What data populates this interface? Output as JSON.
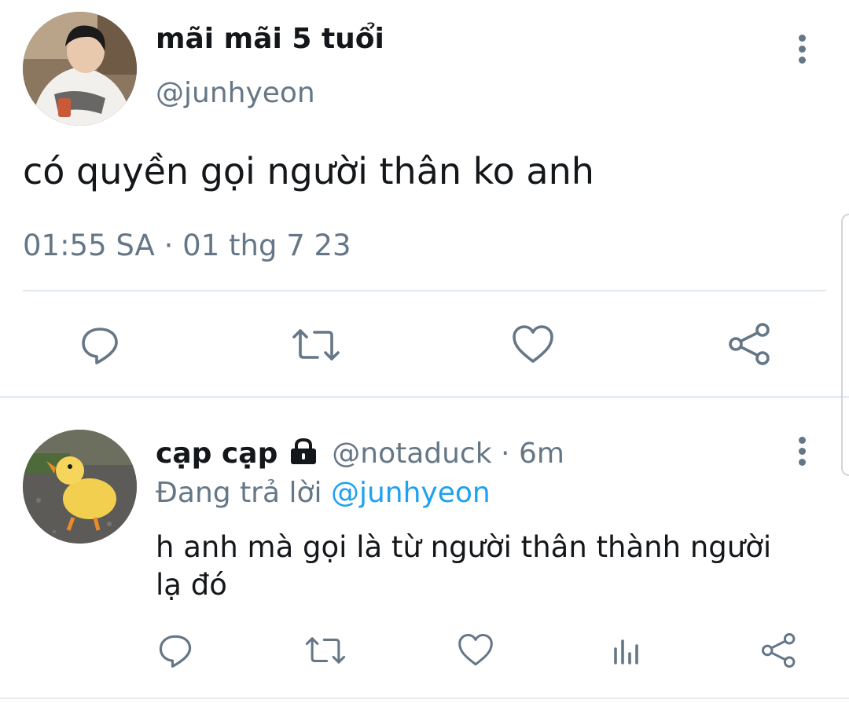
{
  "main_tweet": {
    "display_name": "mãi mãi 5 tuổi",
    "handle": "@junhyeon",
    "text": "có quyền gọi người thân ko anh",
    "timestamp": "01:55 SA · 01 thg 7 23",
    "avatar_icon": "person-in-white-hoodie-photo",
    "actions": [
      "reply-icon",
      "retweet-icon",
      "like-icon",
      "share-icon"
    ]
  },
  "reply": {
    "display_name": "cạp cạp",
    "lock_icon": "lock-icon",
    "handle": "@notaduck",
    "separator": "·",
    "time": "6m",
    "replying_prefix": "Đang trả lời",
    "replying_to": "@junhyeon",
    "text_line1": "h anh mà gọi là từ người thân thành người",
    "text_line2": "lạ đó",
    "avatar_icon": "duckling-photo",
    "actions": [
      "reply-icon",
      "retweet-icon",
      "like-icon",
      "analytics-icon",
      "share-icon"
    ]
  },
  "colors": {
    "text": "#14171a",
    "muted": "#657786",
    "link": "#1da1f2",
    "divider": "#e1e8ed"
  }
}
